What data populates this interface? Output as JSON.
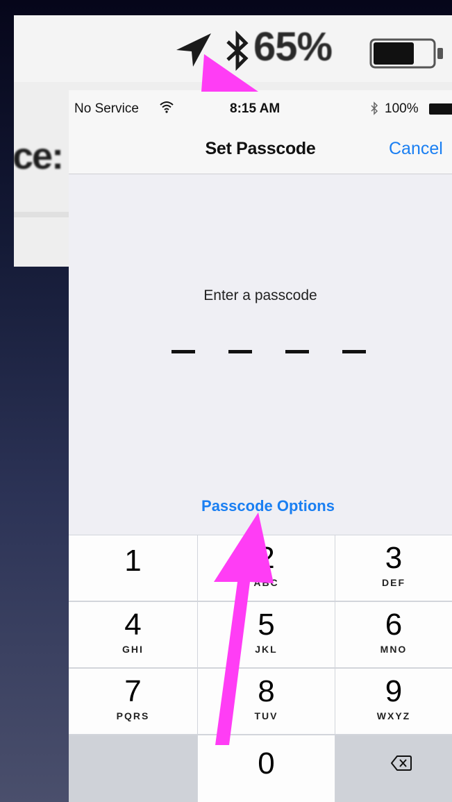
{
  "background_screenshot": {
    "battery_percent": "65%",
    "title_fragment": "ce:"
  },
  "status_bar": {
    "carrier": "No Service",
    "time": "8:15 AM",
    "battery_percent": "100%"
  },
  "nav_bar": {
    "title": "Set Passcode",
    "cancel_label": "Cancel"
  },
  "passcode": {
    "prompt": "Enter a passcode",
    "digit_count": 4,
    "options_link": "Passcode Options"
  },
  "keypad": {
    "keys": [
      {
        "num": "1",
        "letters": ""
      },
      {
        "num": "2",
        "letters": "ABC"
      },
      {
        "num": "3",
        "letters": "DEF"
      },
      {
        "num": "4",
        "letters": "GHI"
      },
      {
        "num": "5",
        "letters": "JKL"
      },
      {
        "num": "6",
        "letters": "MNO"
      },
      {
        "num": "7",
        "letters": "PQRS"
      },
      {
        "num": "8",
        "letters": "TUV"
      },
      {
        "num": "9",
        "letters": "WXYZ"
      },
      {
        "num": "",
        "letters": ""
      },
      {
        "num": "0",
        "letters": ""
      },
      {
        "num": "",
        "letters": ""
      }
    ],
    "delete_icon": "backspace-icon"
  },
  "annotation": {
    "arrow_color": "#ff3df5"
  },
  "colors": {
    "accent_blue": "#1a7ff2",
    "screen_bg": "#efeff4",
    "keypad_bg": "#d2d5db"
  }
}
